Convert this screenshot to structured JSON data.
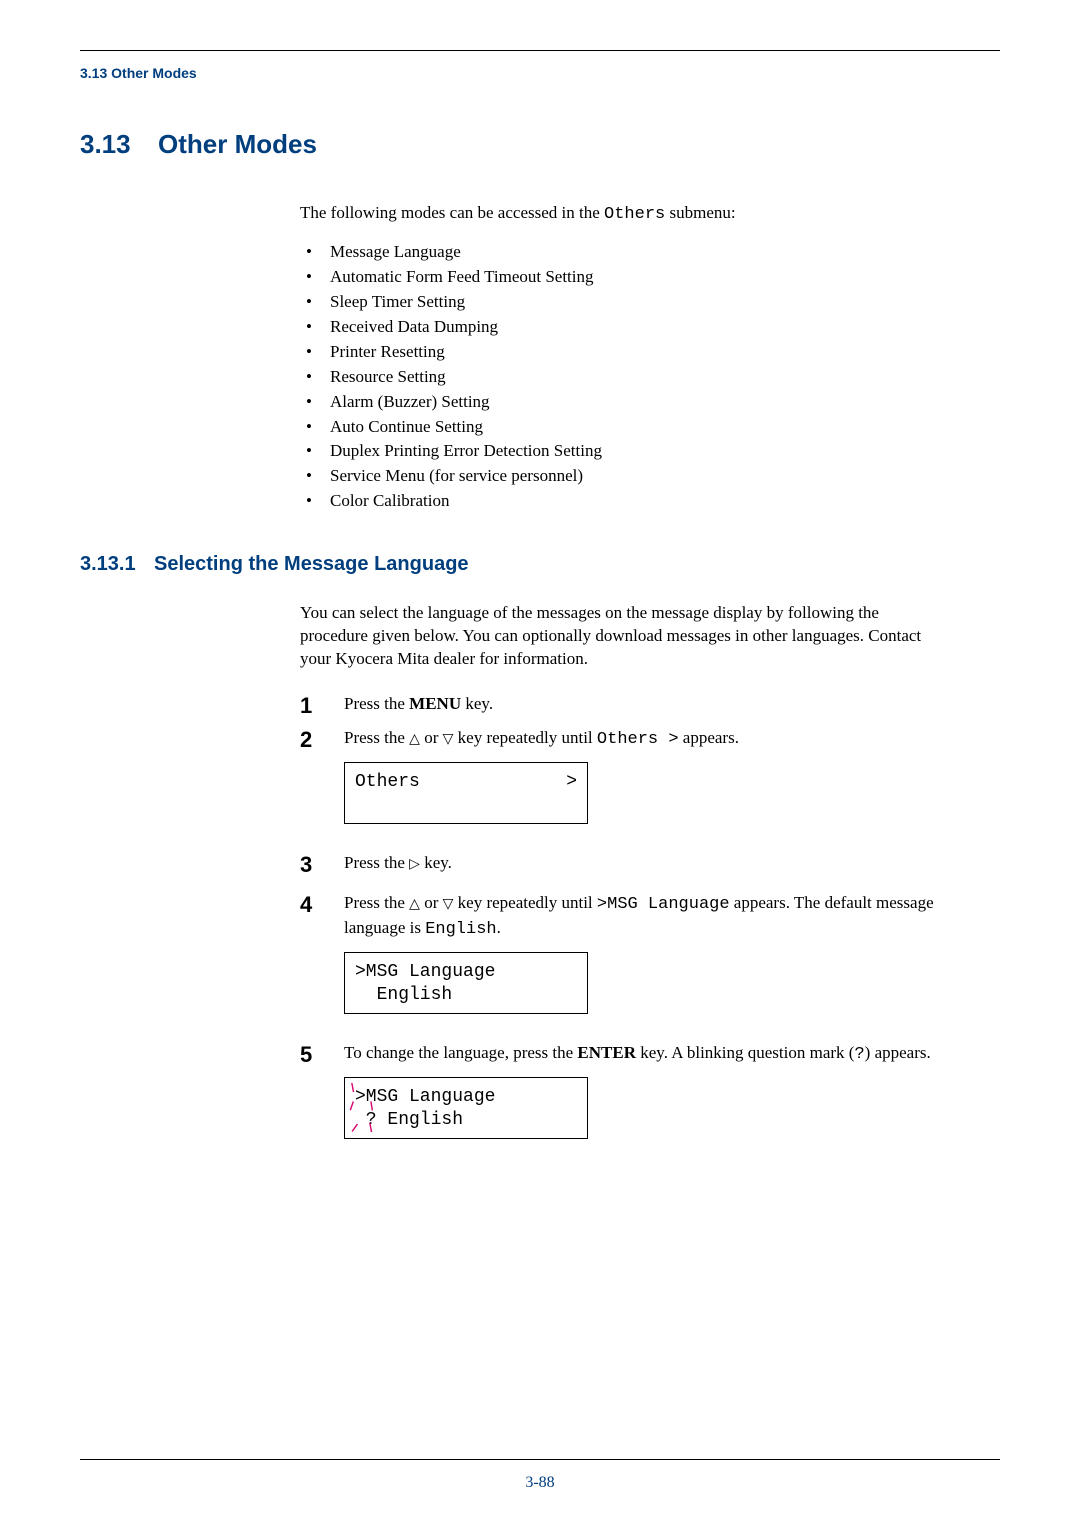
{
  "running_head": "3.13 Other Modes",
  "section": {
    "number": "3.13",
    "title": "Other Modes"
  },
  "intro": {
    "pre": "The following modes can be accessed in the ",
    "code": "Others",
    "post": " submenu:"
  },
  "bullets": [
    "Message Language",
    "Automatic Form Feed Timeout Setting",
    "Sleep Timer Setting",
    "Received Data Dumping",
    "Printer Resetting",
    "Resource Setting",
    "Alarm (Buzzer) Setting",
    "Auto Continue Setting",
    "Duplex Printing Error Detection Setting",
    "Service Menu (for service personnel)",
    "Color Calibration"
  ],
  "subsection": {
    "number": "3.13.1",
    "title": "Selecting the Message Language"
  },
  "sub_intro": "You can select the language of the messages on the message display by following the procedure given below. You can optionally download messages in other languages. Contact your Kyocera Mita dealer for information.",
  "steps": {
    "s1": {
      "num": "1",
      "pre": "Press the ",
      "bold": "MENU",
      "post": " key."
    },
    "s2": {
      "num": "2",
      "pre": "Press the ",
      "mid": " key repeatedly until ",
      "code": "Others >",
      "post": " appears."
    },
    "s3": {
      "num": "3",
      "pre": "Press the ",
      "post": " key."
    },
    "s4": {
      "num": "4",
      "pre": "Press the ",
      "mid": " key repeatedly until ",
      "code1": ">MSG Language",
      "mid2": " appears. The default message language is ",
      "code2": "English",
      "post": "."
    },
    "s5": {
      "num": "5",
      "pre": "To change the language, press the ",
      "bold": "ENTER",
      "mid": " key. A blinking question mark (",
      "code": "?",
      "post": ") appears."
    }
  },
  "display1": {
    "left": "Others",
    "right": ">"
  },
  "display2": {
    "line1": ">MSG Language",
    "line2": "  English"
  },
  "display3": {
    "line1": ">MSG Language",
    "line2": " ? English"
  },
  "page_num": "3-88",
  "glyph_tri_up": "△",
  "glyph_tri_down": "▽",
  "glyph_tri_right": "▷",
  "glyph_or": " or "
}
